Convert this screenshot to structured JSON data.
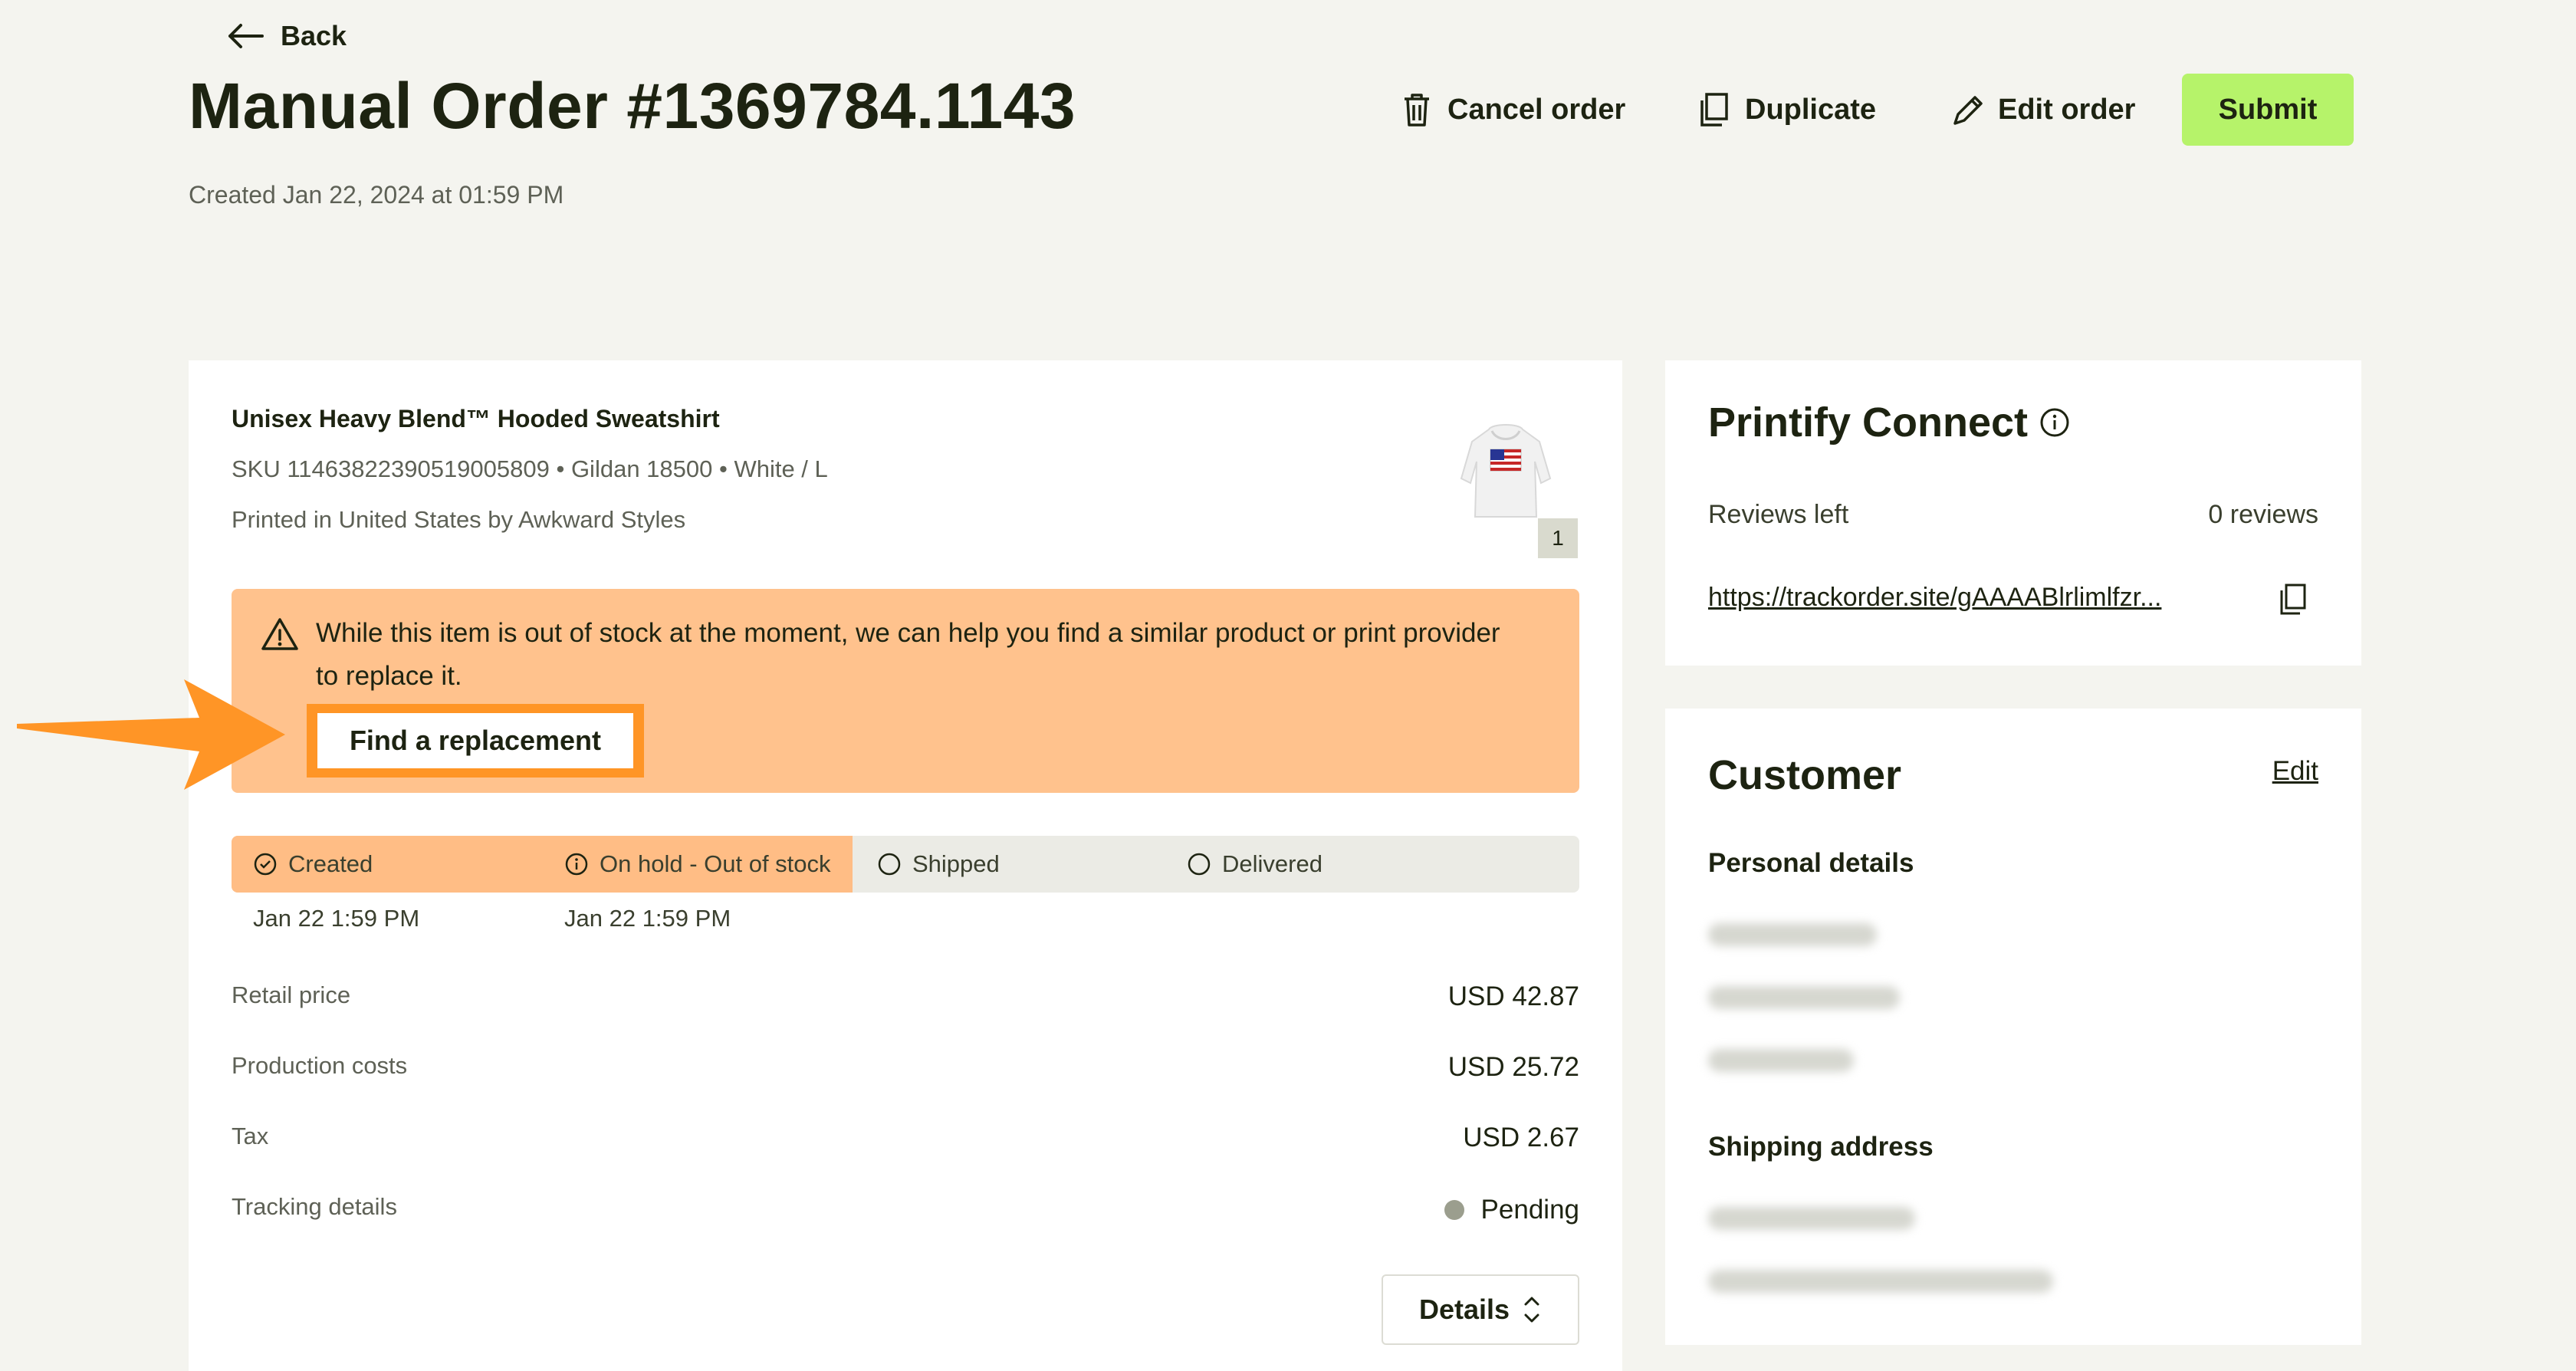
{
  "header": {
    "back_label": "Back",
    "title": "Manual Order #1369784.1143",
    "created": "Created Jan 22, 2024 at 01:59 PM",
    "actions": {
      "cancel": "Cancel order",
      "duplicate": "Duplicate",
      "edit": "Edit order",
      "submit": "Submit"
    }
  },
  "product": {
    "name": "Unisex Heavy Blend™ Hooded Sweatshirt",
    "sku_line": "SKU 11463822390519005809  • Gildan 18500 • White / L",
    "printed": "Printed in United States by Awkward Styles",
    "quantity": "1"
  },
  "alert": {
    "message": "While this item is out of stock at the moment, we can help you find a similar product or print provider to replace it.",
    "button": "Find a replacement"
  },
  "timeline": {
    "steps": [
      {
        "label": "Created",
        "date": "Jan 22 1:59 PM"
      },
      {
        "label": "On hold - Out of stock",
        "date": "Jan 22 1:59 PM"
      },
      {
        "label": "Shipped",
        "date": ""
      },
      {
        "label": "Delivered",
        "date": ""
      }
    ]
  },
  "costs": {
    "retail_label": "Retail price",
    "retail_value": "USD 42.87",
    "production_label": "Production costs",
    "production_value": "USD 25.72",
    "tax_label": "Tax",
    "tax_value": "USD 2.67",
    "tracking_label": "Tracking details",
    "tracking_value": "Pending",
    "details_button": "Details"
  },
  "printify_connect": {
    "title": "Printify Connect",
    "reviews_label": "Reviews left",
    "reviews_value": "0 reviews",
    "link": "https://trackorder.site/gAAAABlrlimlfzr..."
  },
  "customer": {
    "title": "Customer",
    "edit": "Edit",
    "personal_details": "Personal details",
    "shipping_address": "Shipping address"
  },
  "colors": {
    "background": "#f4f4ef",
    "submit": "#b6f36a",
    "alert": "#ffc28d",
    "highlight": "#ff9526"
  }
}
